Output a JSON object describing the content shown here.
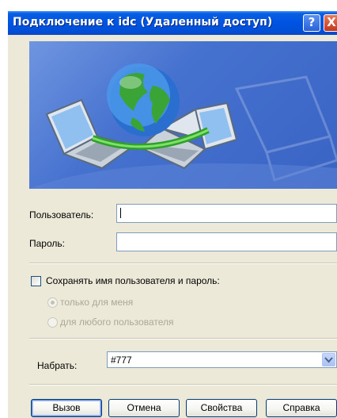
{
  "window": {
    "title": "Подключение к idc (Удаленный доступ)",
    "help_button": "?",
    "close_button": "X"
  },
  "form": {
    "user_label": "Пользователь:",
    "user_value": "",
    "password_label": "Пароль:",
    "password_value": "",
    "save_checkbox_label": "Сохранять имя пользователя и пароль:",
    "save_checked": false,
    "radio_only_me": "только для меня",
    "radio_any_user": "для любого пользователя",
    "dial_label": "Набрать:",
    "dial_value": "#777"
  },
  "buttons": {
    "call": "Вызов",
    "cancel": "Отмена",
    "properties": "Свойства",
    "help": "Справка"
  },
  "icons": {
    "banner": "network-globe-laptops-icon",
    "combo": "chevron-down-icon",
    "help": "question-icon",
    "close": "close-icon"
  },
  "colors": {
    "titlebar": "#0054e3",
    "dialog_bg": "#ece9d8",
    "banner_bg": "#4571cf",
    "button_border": "#003c74"
  }
}
